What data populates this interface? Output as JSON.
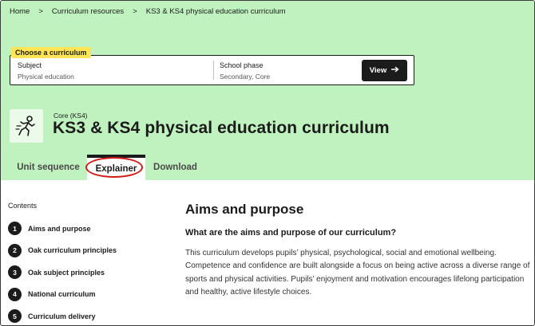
{
  "breadcrumb": [
    {
      "label": "Home"
    },
    {
      "label": "Curriculum resources"
    },
    {
      "label": "KS3 & KS4 physical education curriculum"
    }
  ],
  "breadcrumb_separator": ">",
  "picker": {
    "tag": "Choose a curriculum",
    "subject_label": "Subject",
    "subject_value": "Physical education",
    "phase_label": "School phase",
    "phase_value": "Secondary, Core",
    "view_button": "View",
    "view_icon": "arrow-right-icon"
  },
  "header": {
    "kicker": "Core (KS4)",
    "title": "KS3 & KS4 physical education curriculum",
    "icon": "running-person-icon"
  },
  "tabs": [
    {
      "label": "Unit sequence",
      "active": false
    },
    {
      "label": "Explainer",
      "active": true
    },
    {
      "label": "Download",
      "active": false
    }
  ],
  "contents": {
    "title": "Contents",
    "items": [
      {
        "number": "1",
        "label": "Aims and purpose"
      },
      {
        "number": "2",
        "label": "Oak curriculum principles"
      },
      {
        "number": "3",
        "label": "Oak subject principles"
      },
      {
        "number": "4",
        "label": "National curriculum"
      },
      {
        "number": "5",
        "label": "Curriculum delivery"
      }
    ]
  },
  "article": {
    "title": "Aims and purpose",
    "subtitle": "What are the aims and purpose of our curriculum?",
    "body": "This curriculum develops pupils’ physical, psychological, social and emotional wellbeing. Competence and confidence are built alongside a focus on being active across a diverse range of sports and physical activities. Pupils’ enjoyment and motivation encourages lifelong participation and healthy, active lifestyle choices."
  },
  "colors": {
    "hero_background": "#bff2be",
    "tag_background": "#ffe555",
    "annotation": "#d11a1a",
    "dark": "#1b1b1b"
  }
}
